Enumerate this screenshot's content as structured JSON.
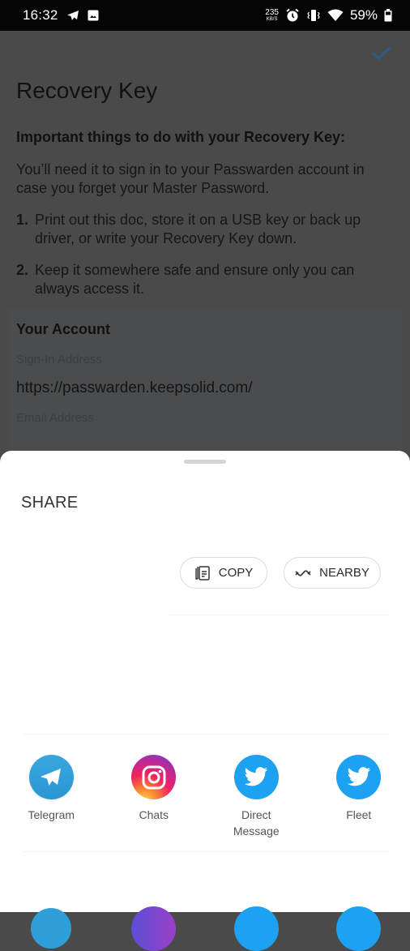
{
  "status_bar": {
    "time": "16:32",
    "left_icons": [
      "telegram-notification-icon",
      "gallery-notification-icon"
    ],
    "net_speed_value": "235",
    "net_speed_unit": "KB/S",
    "right_icons": [
      "alarm-icon",
      "vibrate-icon",
      "wifi-icon",
      "battery-icon"
    ],
    "battery_percent": "59%"
  },
  "page": {
    "confirm_icon": "check-icon",
    "accent_color": "#2f6fb0",
    "title": "Recovery Key",
    "important_heading": "Important things to do with your Recovery Key:",
    "intro": "You’ll need it to sign in to your Passwarden account in case you forget your Master Password.",
    "steps": [
      {
        "num": "1.",
        "text": "Print out this doc, store it on a USB key or back up driver, or write your Recovery Key down."
      },
      {
        "num": "2.",
        "text": "Keep it somewhere safe and ensure only you can always access it."
      }
    ],
    "account": {
      "title": "Your Account",
      "sign_in_label": "Sign-In Address",
      "sign_in_value": "https://passwarden.keepsolid.com/",
      "email_label": "Email Address"
    }
  },
  "share_sheet": {
    "title": "SHARE",
    "actions": [
      {
        "label": "COPY",
        "icon": "copy-icon"
      },
      {
        "label": "NEARBY",
        "icon": "nearby-share-icon"
      }
    ],
    "apps": [
      {
        "label": "Telegram",
        "icon": "telegram-icon",
        "color": "#2f9fd9"
      },
      {
        "label": "Chats",
        "icon": "instagram-icon",
        "color": "#e1306c"
      },
      {
        "label": "Direct Message",
        "icon": "twitter-icon",
        "color": "#1da1f2"
      },
      {
        "label": "Fleet",
        "icon": "twitter-icon",
        "color": "#1da1f2"
      }
    ]
  }
}
